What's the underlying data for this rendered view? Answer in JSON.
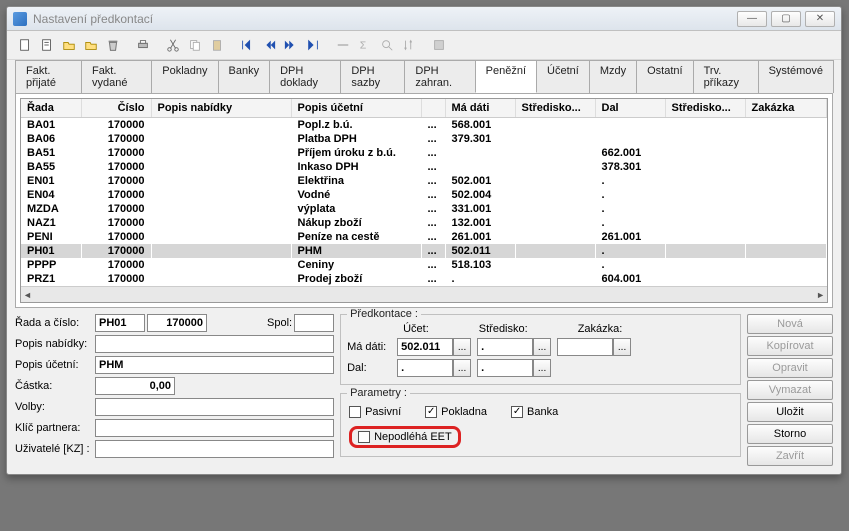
{
  "window": {
    "title": "Nastavení předkontací"
  },
  "tabs": [
    "Fakt. přijaté",
    "Fakt. vydané",
    "Pokladny",
    "Banky",
    "DPH doklady",
    "DPH sazby",
    "DPH zahran.",
    "Peněžní",
    "Účetní",
    "Mzdy",
    "Ostatní",
    "Trv. příkazy",
    "Systémové"
  ],
  "activeTab": "Peněžní",
  "columns": [
    "Řada",
    "Číslo",
    "Popis nabídky",
    "Popis účetní",
    "",
    "Má dáti",
    "Středisko...",
    "Dal",
    "Středisko...",
    "Zakázka"
  ],
  "rows": [
    {
      "rada": "BA01",
      "cislo": "170000",
      "nabidka": "",
      "ucetni": "Popl.z b.ú.",
      "lk": "...",
      "md": "568.001",
      "str1": "",
      "dal": "",
      "str2": "",
      "zak": ""
    },
    {
      "rada": "BA06",
      "cislo": "170000",
      "nabidka": "",
      "ucetni": "Platba DPH",
      "lk": "...",
      "md": "379.301",
      "str1": "",
      "dal": "",
      "str2": "",
      "zak": ""
    },
    {
      "rada": "BA51",
      "cislo": "170000",
      "nabidka": "",
      "ucetni": "Příjem úroku z b.ú.",
      "lk": "...",
      "md": "",
      "str1": "",
      "dal": "662.001",
      "str2": "",
      "zak": ""
    },
    {
      "rada": "BA55",
      "cislo": "170000",
      "nabidka": "",
      "ucetni": "Inkaso DPH",
      "lk": "...",
      "md": "",
      "str1": "",
      "dal": "378.301",
      "str2": "",
      "zak": ""
    },
    {
      "rada": "EN01",
      "cislo": "170000",
      "nabidka": "",
      "ucetni": "Elektřina",
      "lk": "...",
      "md": "502.001",
      "str1": "",
      "dal": ".",
      "str2": "",
      "zak": ""
    },
    {
      "rada": "EN04",
      "cislo": "170000",
      "nabidka": "",
      "ucetni": "Vodné",
      "lk": "...",
      "md": "502.004",
      "str1": "",
      "dal": ".",
      "str2": "",
      "zak": ""
    },
    {
      "rada": "MZDA",
      "cislo": "170000",
      "nabidka": "",
      "ucetni": "výplata",
      "lk": "...",
      "md": "331.001",
      "str1": "",
      "dal": ".",
      "str2": "",
      "zak": ""
    },
    {
      "rada": "NAZ1",
      "cislo": "170000",
      "nabidka": "",
      "ucetni": "Nákup zboží",
      "lk": "...",
      "md": "132.001",
      "str1": "",
      "dal": ".",
      "str2": "",
      "zak": ""
    },
    {
      "rada": "PENI",
      "cislo": "170000",
      "nabidka": "",
      "ucetni": "Peníze na cestě",
      "lk": "...",
      "md": "261.001",
      "str1": "",
      "dal": "261.001",
      "str2": "",
      "zak": ""
    },
    {
      "rada": "PH01",
      "cislo": "170000",
      "nabidka": "",
      "ucetni": "PHM",
      "lk": "...",
      "md": "502.011",
      "str1": "",
      "dal": ".",
      "str2": "",
      "zak": "",
      "sel": true
    },
    {
      "rada": "PPPP",
      "cislo": "170000",
      "nabidka": "",
      "ucetni": "Ceniny",
      "lk": "...",
      "md": "518.103",
      "str1": "",
      "dal": ".",
      "str2": "",
      "zak": ""
    },
    {
      "rada": "PRZ1",
      "cislo": "170000",
      "nabidka": "",
      "ucetni": "Prodej zboží",
      "lk": "...",
      "md": ".",
      "str1": "",
      "dal": "604.001",
      "str2": "",
      "zak": ""
    }
  ],
  "form": {
    "radaCisloLabel": "Řada a číslo:",
    "rada": "PH01",
    "cislo": "170000",
    "spolLabel": "Spol:",
    "spol": "",
    "popisNabidkyLabel": "Popis nabídky:",
    "popisNabidky": "",
    "popisUcetniLabel": "Popis účetní:",
    "popisUcetni": "PHM",
    "castkaLabel": "Částka:",
    "castka": "0,00",
    "volbyLabel": "Volby:",
    "volby": "",
    "klicLabel": "Klíč partnera:",
    "klic": "",
    "uzivLabel": "Uživatelé [KZ] :",
    "uziv": ""
  },
  "predkontace": {
    "legend": "Předkontace :",
    "ucetLabel": "Účet:",
    "strediskoLabel": "Středisko:",
    "zakazkaLabel": "Zakázka:",
    "mdLabel": "Má dáti:",
    "md": "502.011",
    "mdStr": ".",
    "mdZak": "",
    "dalLabel": "Dal:",
    "dal": ".",
    "dalStr": ".",
    "dalZak": ""
  },
  "parametry": {
    "legend": "Parametry :",
    "pasivni": "Pasivní",
    "pokladna": "Pokladna",
    "banka": "Banka",
    "eet": "Nepodléhá EET",
    "pasivniChecked": false,
    "pokladnaChecked": true,
    "bankaChecked": true,
    "eetChecked": false
  },
  "buttons": {
    "nova": "Nová",
    "kopirovat": "Kopírovat",
    "opravit": "Opravit",
    "vymazat": "Vymazat",
    "ulozit": "Uložit",
    "storno": "Storno",
    "zavrit": "Zavřít"
  }
}
